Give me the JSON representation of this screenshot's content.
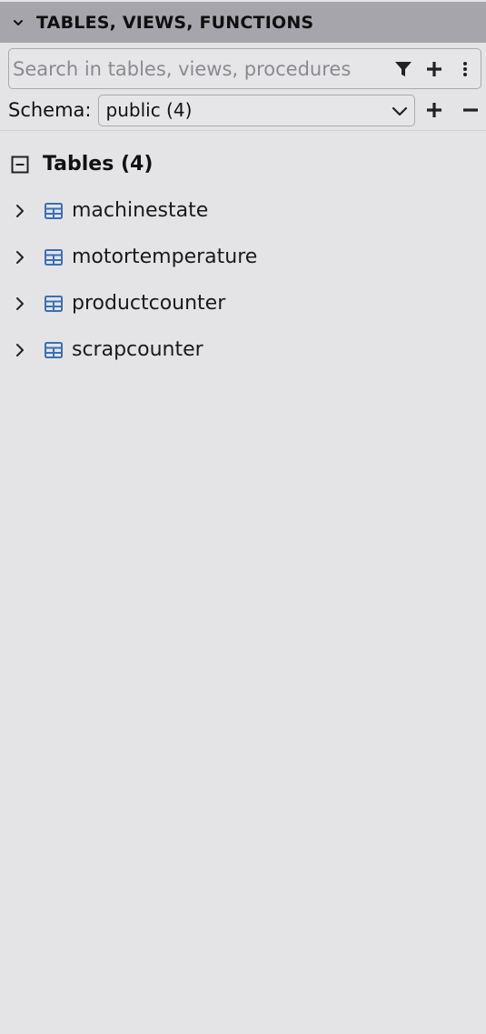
{
  "panel": {
    "title": "TABLES, VIEWS, FUNCTIONS"
  },
  "search": {
    "placeholder": "Search in tables, views, procedures",
    "value": ""
  },
  "schema": {
    "label": "Schema:",
    "selected": "public (4)"
  },
  "tree": {
    "group": {
      "label": "Tables (4)",
      "expanded": true
    },
    "items": [
      {
        "name": "machinestate"
      },
      {
        "name": "motortemperature"
      },
      {
        "name": "productcounter"
      },
      {
        "name": "scrapcounter"
      }
    ]
  },
  "colors": {
    "header_bg": "#a5a5ab",
    "panel_bg": "#e4e4e7",
    "table_icon": "#3b6fb5"
  }
}
